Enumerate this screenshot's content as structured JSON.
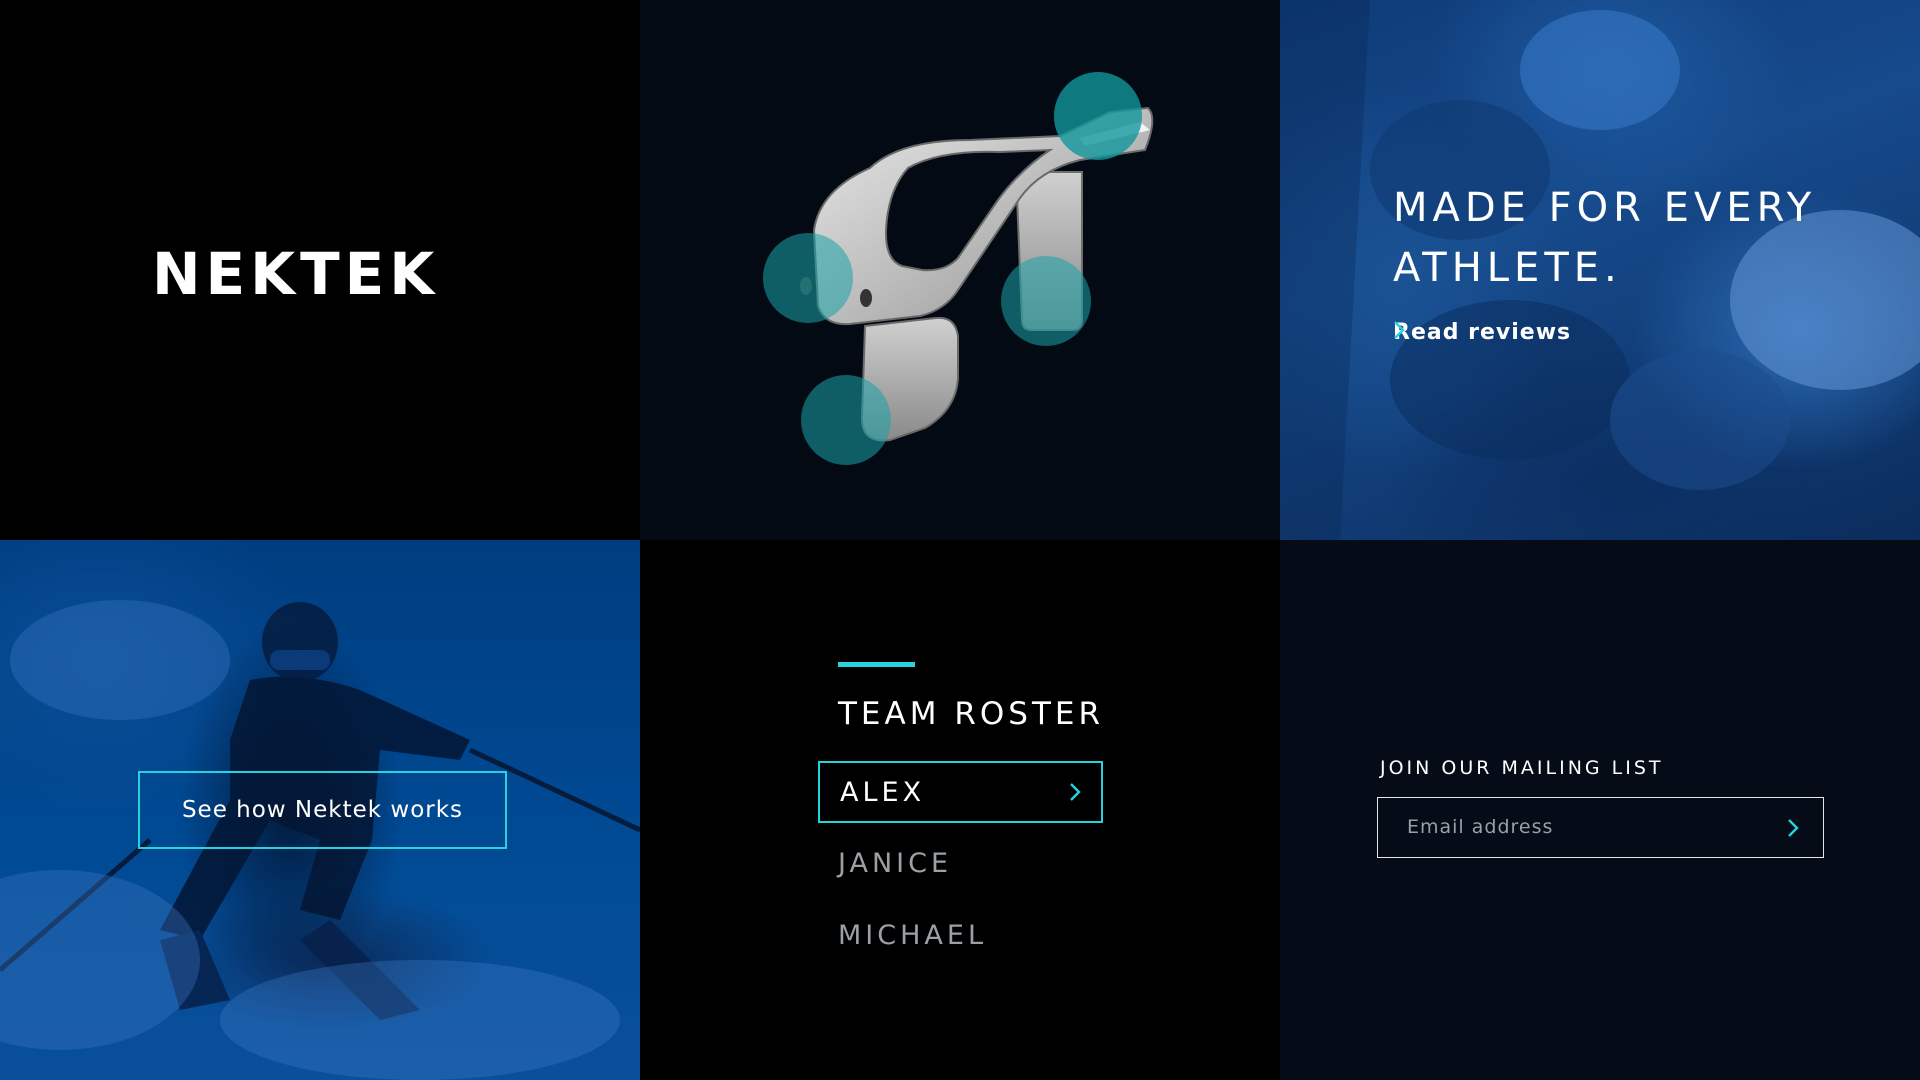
{
  "brand": {
    "logo_text": "NEKTEK"
  },
  "hero": {
    "headline": "MADE FOR EVERY ATHLETE.",
    "reviews_link": "Read reviews",
    "chevron_icon": "chevron-right-icon"
  },
  "how_it_works": {
    "button_label": "See how Nektek works"
  },
  "roster": {
    "title": "TEAM ROSTER",
    "items": [
      {
        "label": "ALEX",
        "selected": true
      },
      {
        "label": "JANICE",
        "selected": false
      },
      {
        "label": "MICHAEL",
        "selected": false
      }
    ]
  },
  "mailing": {
    "label": "JOIN OUR MAILING LIST",
    "email_placeholder": "Email address",
    "email_value": ""
  },
  "colors": {
    "accent": "#27d2dc",
    "background": "#000000",
    "panel_dark": "#050b17",
    "photo_blue": "#0a4a96"
  }
}
